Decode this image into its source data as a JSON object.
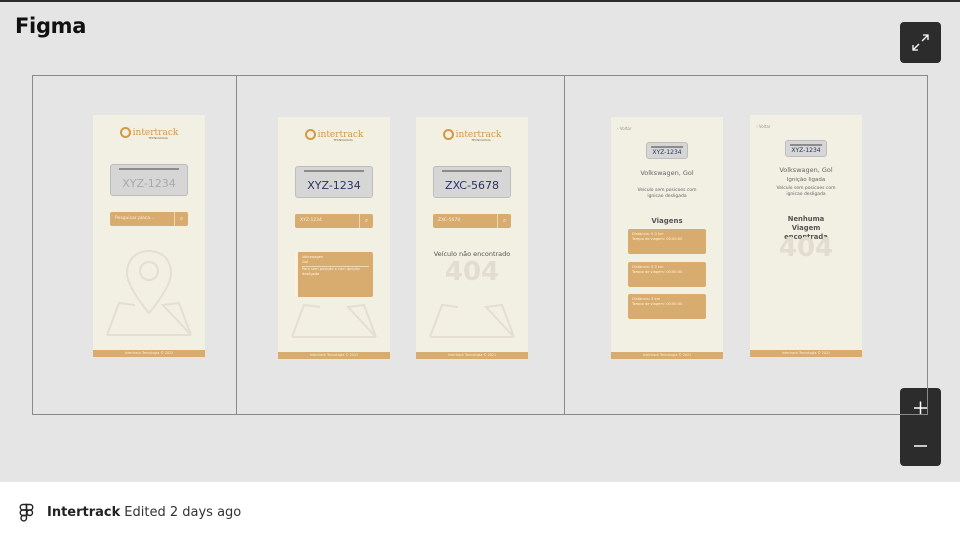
{
  "viewer": {
    "logo": "Figma",
    "controls": {
      "expand_icon": "expand-icon",
      "zoom_in_icon": "plus-icon",
      "zoom_out_icon": "minus-icon"
    }
  },
  "frames": {
    "home": {
      "brand": "intertrack",
      "brand_sub": "TECNOLOGIA",
      "plate": "XYZ-1234",
      "search_placeholder": "Pesquisar placa...",
      "footer": "Intertrack Tecnologia © 2021"
    },
    "found": {
      "brand": "intertrack",
      "brand_sub": "TECNOLOGIA",
      "plate": "XYZ-1234",
      "search_value": "XYZ-1234",
      "card_title": "Volkswagen",
      "card_sub": "Gol",
      "card_text": "Para sem posição e com ignição desligada",
      "footer": "Intertrack Tecnologia © 2021"
    },
    "not_found": {
      "brand": "intertrack",
      "brand_sub": "TECNOLOGIA",
      "plate": "ZXC-5678",
      "search_value": "ZXC-5678",
      "message": "Veículo não encontrado",
      "code": "404",
      "footer": "Intertrack Tecnologia © 2021"
    },
    "trips": {
      "back": "Voltar",
      "plate": "XYZ-1234",
      "vehicle": "Volkswagen, Gol",
      "status": "Veículo sem posicoes com ignicao desligada",
      "heading": "Viagens",
      "trip_items": [
        {
          "line1": "Distância: 5.3 km",
          "line2": "Tempo de viagem: 00:00:00"
        },
        {
          "line1": "Distância: 5.3 km",
          "line2": "Tempo de viagem: 00:00:00"
        },
        {
          "line1": "Distância: 3 km",
          "line2": "Tempo de viagem: 00:00:00"
        }
      ],
      "footer": "Intertrack Tecnologia © 2021"
    },
    "no_trips": {
      "back": "Voltar",
      "plate": "XYZ-1234",
      "vehicle": "Volkswagen, Gol",
      "ignition": "Ignição ligada",
      "status": "Veículo sem posicoes com ignicao desligada",
      "message": "Nenhuma Viagem encontrada",
      "code": "404",
      "footer": "Intertrack Tecnologia © 2021"
    }
  },
  "file": {
    "name": "Intertrack",
    "edited": "Edited 2 days ago",
    "icon": "figma-icon"
  }
}
